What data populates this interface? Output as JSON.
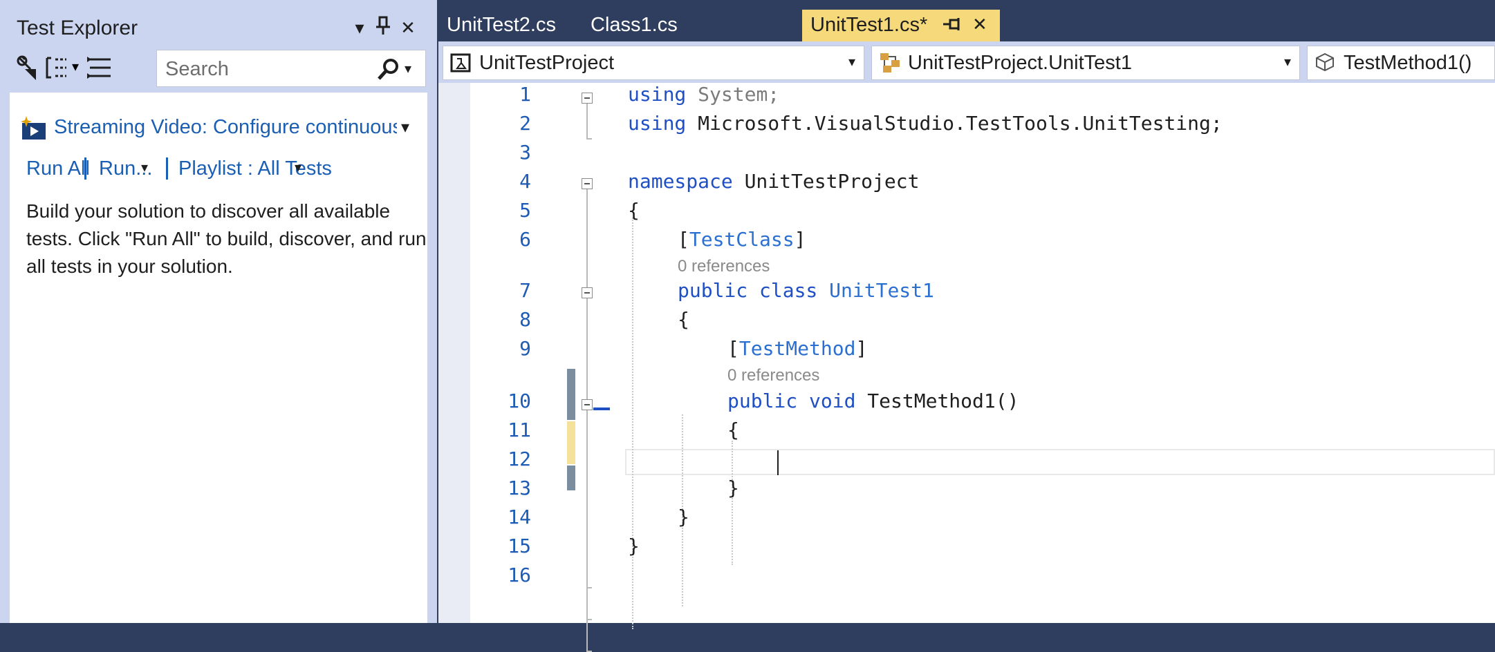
{
  "test_explorer": {
    "title": "Test Explorer",
    "search_placeholder": "Search",
    "video_link": "Streaming Video: Configure continuous testing",
    "actions": {
      "run_all": "Run All",
      "run": "Run...",
      "playlist": "Playlist : All Tests"
    },
    "message": "Build your solution to discover all available tests. Click \"Run All\" to build, discover, and run all tests in your solution."
  },
  "editor": {
    "tabs": [
      {
        "label": "UnitTest2.cs",
        "active": false
      },
      {
        "label": "Class1.cs",
        "active": false
      },
      {
        "label": "UnitTest1.cs*",
        "active": true
      }
    ],
    "nav": {
      "project": "UnitTestProject",
      "class": "UnitTestProject.UnitTest1",
      "member": "TestMethod1()"
    },
    "references_label": "0 references",
    "lines": [
      {
        "n": "1"
      },
      {
        "n": "2"
      },
      {
        "n": "3"
      },
      {
        "n": "4"
      },
      {
        "n": "5"
      },
      {
        "n": "6"
      },
      {
        "n": "7"
      },
      {
        "n": "8"
      },
      {
        "n": "9"
      },
      {
        "n": "10"
      },
      {
        "n": "11"
      },
      {
        "n": "12"
      },
      {
        "n": "13"
      },
      {
        "n": "14"
      },
      {
        "n": "15"
      },
      {
        "n": "16"
      }
    ],
    "code": {
      "l1_kw": "using",
      "l1_rest": " System;",
      "l2_kw": "using",
      "l2_rest": " Microsoft.VisualStudio.TestTools.UnitTesting;",
      "l4_kw": "namespace",
      "l4_rest": " UnitTestProject",
      "open_brace": "{",
      "close_brace": "}",
      "l6_open": "[",
      "l6_attr": "TestClass",
      "l6_close": "]",
      "l7_kw": "public class",
      "l7_type": " UnitTest1",
      "l9_open": "[",
      "l9_attr": "TestMethod",
      "l9_close": "]",
      "l10_kw": "public void",
      "l10_rest": " TestMethod1()"
    }
  },
  "colors": {
    "accent_tab": "#f5d97a",
    "keyword": "#1e4fc4",
    "link": "#1a5fb4",
    "frame": "#2f3e5e",
    "changed_saved": "#7a8ea0",
    "changed_unsaved": "#f5e29a"
  }
}
